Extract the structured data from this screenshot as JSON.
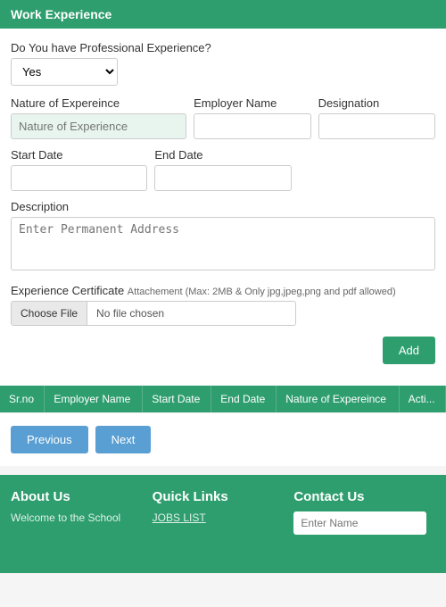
{
  "header": {
    "title": "Work Experience"
  },
  "form": {
    "professional_experience_label": "Do You have Professional Experience?",
    "professional_experience_value": "Yes",
    "nature_label": "Nature of Expereince",
    "nature_placeholder": "Nature of Experience",
    "employer_label": "Employer Name",
    "employer_placeholder": "",
    "designation_label": "Designation",
    "designation_placeholder": "",
    "start_date_label": "Start Date",
    "start_date_placeholder": "",
    "end_date_label": "End Date",
    "end_date_placeholder": "",
    "description_label": "Description",
    "description_placeholder": "Enter Permanent Address",
    "cert_label": "Experience Certificate",
    "cert_note": "Attachement (Max: 2MB & Only jpg,jpeg,png and pdf allowed)",
    "choose_file_btn": "Choose File",
    "no_file_text": "No file chosen",
    "add_btn": "Add"
  },
  "table": {
    "columns": [
      "Sr.no",
      "Employer Name",
      "Start Date",
      "End Date",
      "Nature of Expereince",
      "Acti..."
    ]
  },
  "navigation": {
    "previous_btn": "Previous",
    "next_btn": "Next"
  },
  "footer": {
    "about_title": "About Us",
    "about_text": "Welcome to the School",
    "quick_links_title": "Quick Links",
    "jobs_list_link": "JOBS LIST",
    "contact_title": "Contact Us",
    "contact_placeholder": "Enter Name"
  }
}
